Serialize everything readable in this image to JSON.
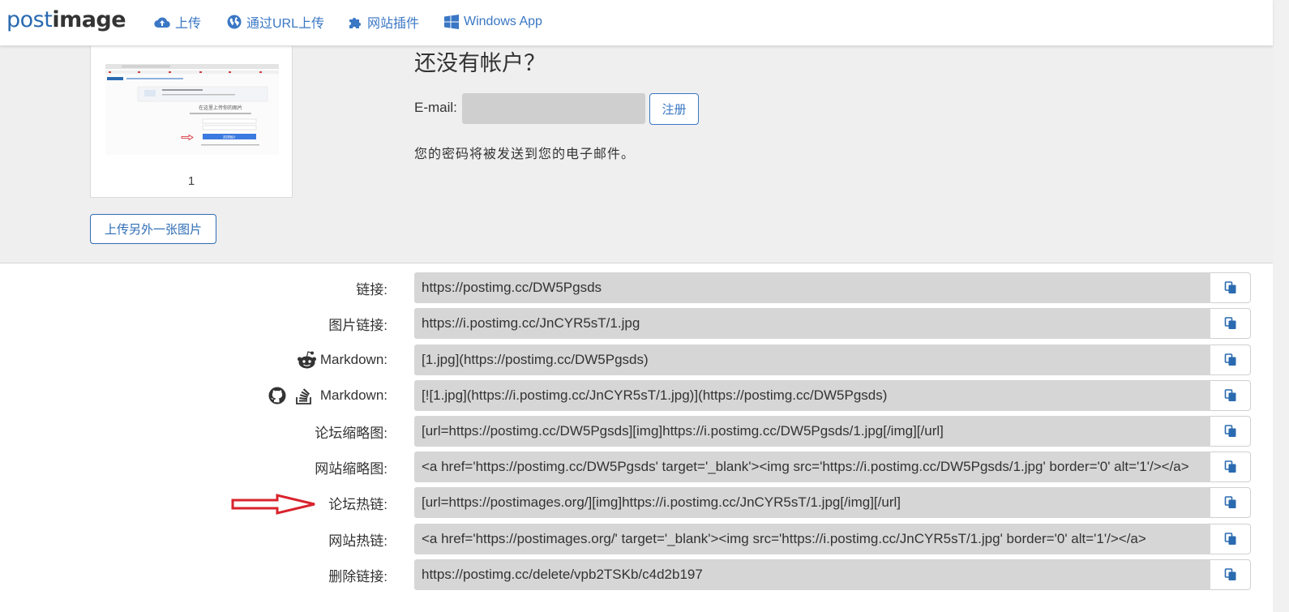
{
  "brand": {
    "part1": "post",
    "part2": "image"
  },
  "nav": {
    "items": [
      {
        "label": "上传",
        "icon": "cloud-upload-icon"
      },
      {
        "label": "通过URL上传",
        "icon": "globe-icon"
      },
      {
        "label": "网站插件",
        "icon": "puzzle-icon"
      },
      {
        "label": "Windows App",
        "icon": "windows-icon"
      }
    ]
  },
  "upload": {
    "thumb_caption": "1",
    "upload_another_label": "上传另外一张图片",
    "preview": {
      "heading": "在这里上传你的图片",
      "button": "选择图片"
    }
  },
  "account": {
    "title": "还没有帐户？",
    "email_label": "E-mail:",
    "email_value": "",
    "register_label": "注册",
    "password_note": "您的密码将被发送到您的电子邮件。"
  },
  "links": [
    {
      "label": "链接:",
      "value": "https://postimg.cc/DW5Pgsds"
    },
    {
      "label": "图片链接:",
      "value": "https://i.postimg.cc/JnCYR5sT/1.jpg"
    },
    {
      "label": "Markdown:",
      "value": "[1.jpg](https://postimg.cc/DW5Pgsds)",
      "icons": [
        "reddit-icon"
      ]
    },
    {
      "label": "Markdown:",
      "value": "[![1.jpg](https://i.postimg.cc/JnCYR5sT/1.jpg)](https://postimg.cc/DW5Pgsds)",
      "icons": [
        "github-icon",
        "stackoverflow-icon"
      ]
    },
    {
      "label": "论坛缩略图:",
      "value": "[url=https://postimg.cc/DW5Pgsds][img]https://i.postimg.cc/DW5Pgsds/1.jpg[/img][/url]"
    },
    {
      "label": "网站缩略图:",
      "value": "<a href='https://postimg.cc/DW5Pgsds' target='_blank'><img src='https://i.postimg.cc/DW5Pgsds/1.jpg' border='0' alt='1'/></a>"
    },
    {
      "label": "论坛热链:",
      "value": "[url=https://postimages.org/][img]https://i.postimg.cc/JnCYR5sT/1.jpg[/img][/url]"
    },
    {
      "label": "网站热链:",
      "value": "<a href='https://postimages.org/' target='_blank'><img src='https://i.postimg.cc/JnCYR5sT/1.jpg' border='0' alt='1'/></a>"
    },
    {
      "label": "删除链接:",
      "value": "https://postimg.cc/delete/vpb2TSKb/c4d2b197"
    }
  ],
  "colors": {
    "accent": "#3a77c4",
    "field_bg": "#d6d6d6",
    "section_bg": "#efefef",
    "annotation_arrow": "#d9232d"
  }
}
